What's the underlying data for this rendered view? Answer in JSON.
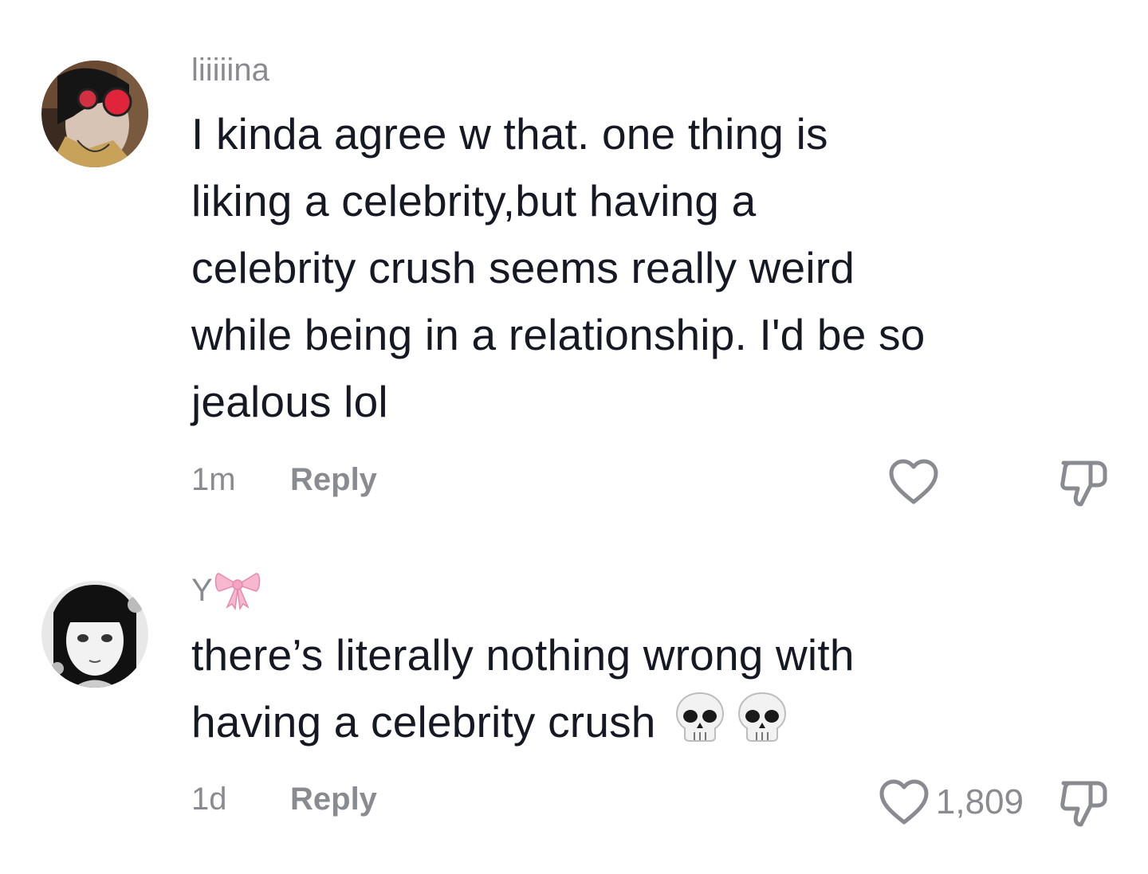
{
  "comments": [
    {
      "username": "liiiiina",
      "text_lines": [
        "I kinda agree w that. one thing is",
        "liking a celebrity,but having a",
        "celebrity crush seems really weird",
        "while being in a relationship. I'd be so",
        "jealous lol"
      ],
      "time": "1m",
      "reply_label": "Reply",
      "like_count": "",
      "avatar_icon": "avatar-red-glasses",
      "like_icon": "heart-outline-icon",
      "dislike_icon": "thumbs-down-icon"
    },
    {
      "username": "Y",
      "username_emoji": "pink-ribbon-bow",
      "text_lines": [
        "there’s literally nothing wrong with",
        "having a celebrity crush"
      ],
      "text_emoji": [
        "skull",
        "skull"
      ],
      "time": "1d",
      "reply_label": "Reply",
      "like_count": "1,809",
      "avatar_icon": "avatar-anime-girl-bw",
      "like_icon": "heart-outline-icon",
      "dislike_icon": "thumbs-down-icon"
    }
  ],
  "colors": {
    "text": "#161823",
    "muted": "#8a8b91",
    "background": "#ffffff",
    "bow_pink": "#f7b8cf"
  }
}
